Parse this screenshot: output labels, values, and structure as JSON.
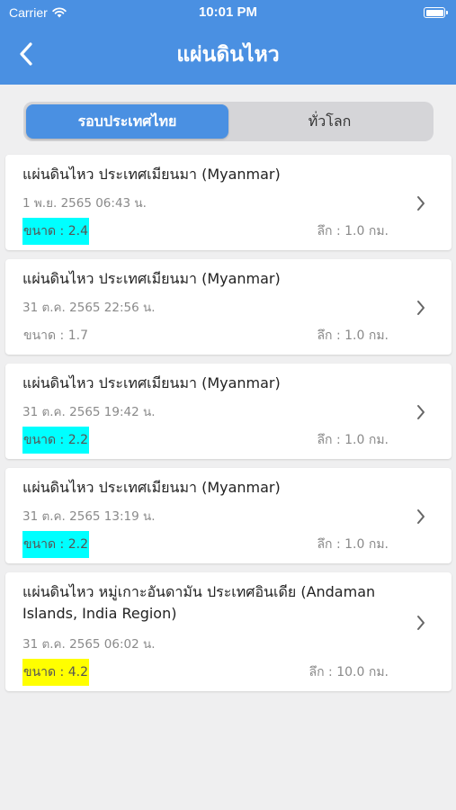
{
  "status": {
    "carrier": "Carrier",
    "time": "10:01 PM"
  },
  "nav": {
    "title": "แผ่นดินไหว"
  },
  "segments": [
    "รอบประเทศไทย",
    "ทั่วโลก"
  ],
  "quakes": [
    {
      "title": "แผ่นดินไหว ประเทศเมียนมา (Myanmar)",
      "date": "1 พ.ย. 2565 06:43 น.",
      "magnitude": "ขนาด : 2.4",
      "depth": "ลึก : 1.0 กม."
    },
    {
      "title": "แผ่นดินไหว ประเทศเมียนมา (Myanmar)",
      "date": "31 ต.ค. 2565 22:56 น.",
      "magnitude": "ขนาด : 1.7",
      "depth": "ลึก : 1.0 กม."
    },
    {
      "title": "แผ่นดินไหว ประเทศเมียนมา (Myanmar)",
      "date": "31 ต.ค. 2565 19:42 น.",
      "magnitude": "ขนาด : 2.2",
      "depth": "ลึก : 1.0 กม."
    },
    {
      "title": "แผ่นดินไหว ประเทศเมียนมา (Myanmar)",
      "date": "31 ต.ค. 2565 13:19 น.",
      "magnitude": "ขนาด : 2.2",
      "depth": "ลึก : 1.0 กม."
    },
    {
      "title": "แผ่นดินไหว หมู่เกาะอันดามัน ประเทศอินเดีย (Andaman Islands, India Region)",
      "date": "31 ต.ค. 2565 06:02 น.",
      "magnitude": "ขนาด : 4.2",
      "depth": "ลึก : 10.0 กม."
    }
  ],
  "colors": {
    "header": "#4a90e2",
    "highlight_low": "#00ffff",
    "highlight_mid": "#ffff00"
  }
}
